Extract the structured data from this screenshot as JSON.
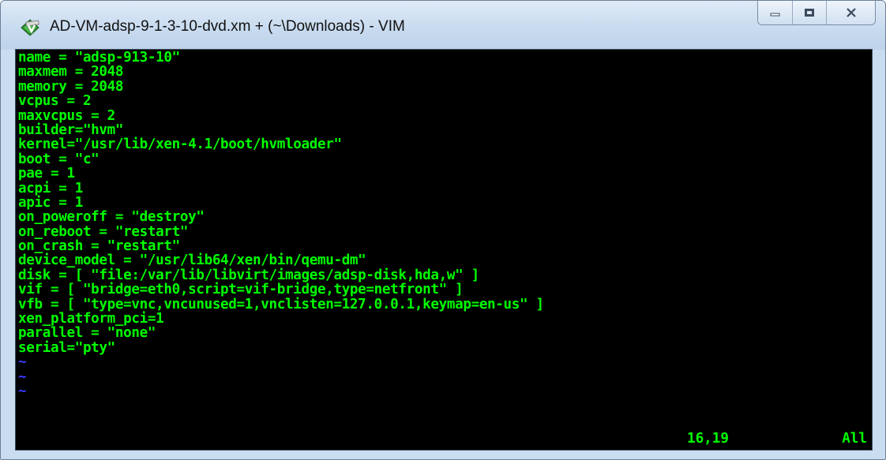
{
  "window": {
    "title": "AD-VM-adsp-9-1-3-10-dvd.xm + (~\\Downloads) - VIM",
    "controls": {
      "minimize_icon": "minimize-icon",
      "maximize_icon": "maximize-icon",
      "close_icon": "close-icon"
    }
  },
  "colors": {
    "text": "#00ff00",
    "tilde": "#3a3aff",
    "background": "#000000",
    "chrome": "#c9dcf0"
  },
  "buffer": {
    "lines": [
      "name = \"adsp-913-10\"",
      "maxmem = 2048",
      "memory = 2048",
      "vcpus = 2",
      "maxvcpus = 2",
      "builder=\"hvm\"",
      "kernel=\"/usr/lib/xen-4.1/boot/hvmloader\"",
      "boot = \"c\"",
      "pae = 1",
      "acpi = 1",
      "apic = 1",
      "on_poweroff = \"destroy\"",
      "on_reboot = \"restart\"",
      "on_crash = \"restart\"",
      "device_model = \"/usr/lib64/xen/bin/qemu-dm\"",
      "disk = [ \"file:/var/lib/libvirt/images/adsp-disk,hda,w\" ]",
      "vif = [ \"bridge=eth0,script=vif-bridge,type=netfront\" ]",
      "vfb = [ \"type=vnc,vncunused=1,vnclisten=127.0.0.1,keymap=en-us\" ]",
      "xen_platform_pci=1",
      "parallel = \"none\"",
      "serial=\"pty\""
    ],
    "tildes": [
      "~",
      "~",
      "~"
    ]
  },
  "status": {
    "cursor_position": "16,19",
    "scroll_position": "All"
  }
}
